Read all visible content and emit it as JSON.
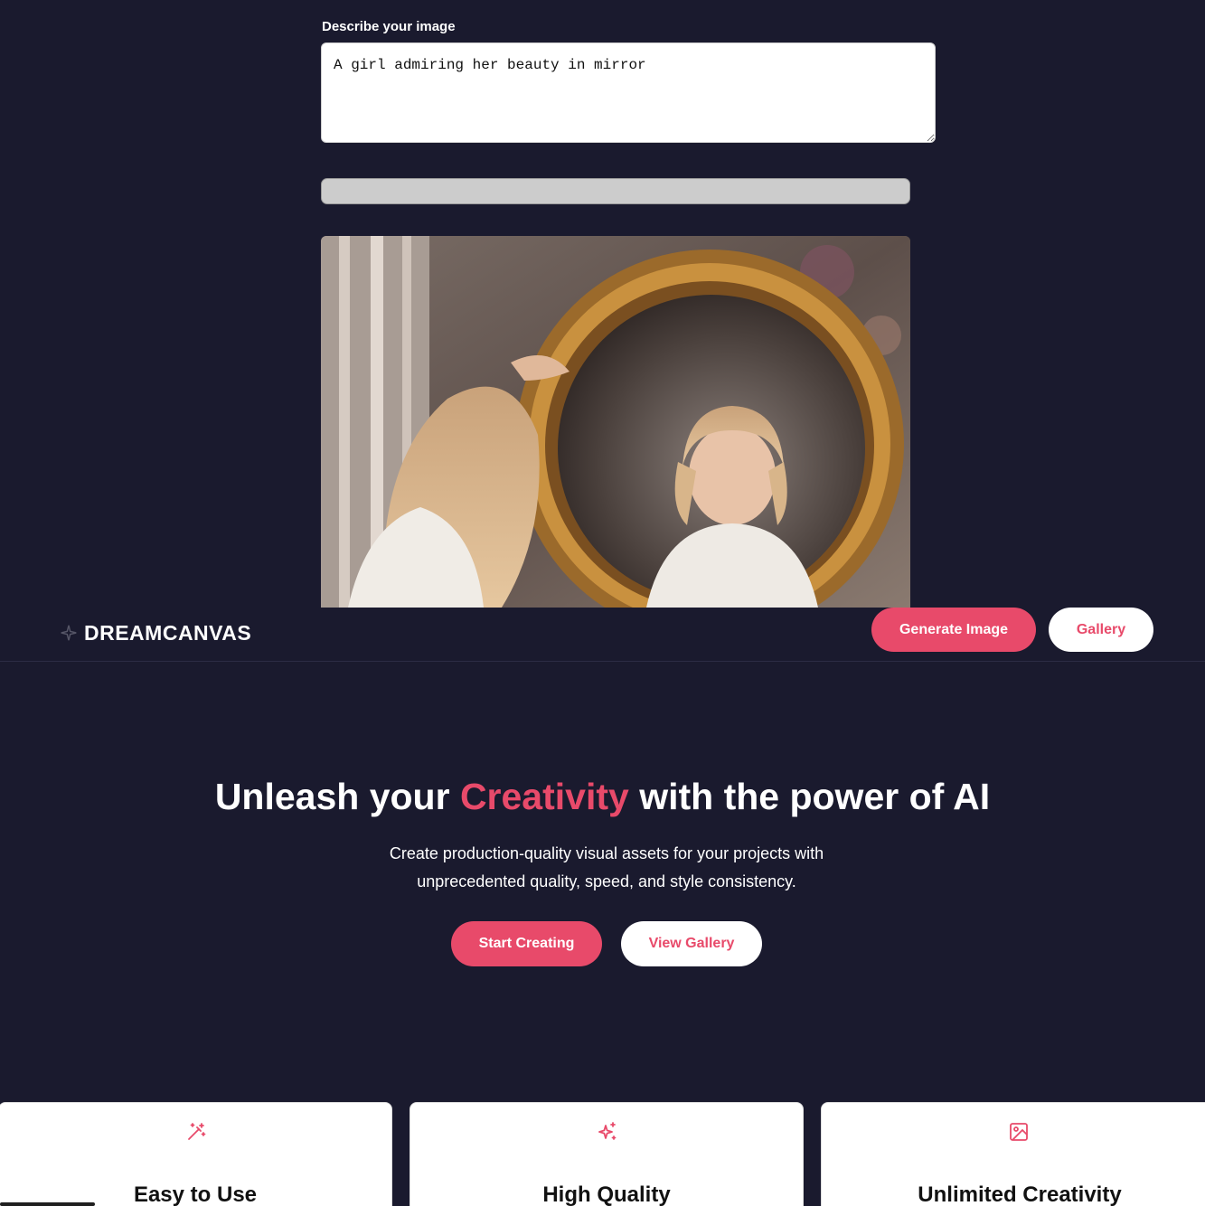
{
  "generator": {
    "label": "Describe your image",
    "prompt_value": "A girl admiring her beauty in mirror",
    "progress": 0,
    "image_alt": "A girl admiring her beauty in mirror"
  },
  "navbar": {
    "brand": "DREAMCANVAS",
    "brand_icon": "sparkle-icon",
    "generate_label": "Generate Image",
    "gallery_label": "Gallery"
  },
  "hero": {
    "title_pre": "Unleash your ",
    "title_accent": "Creativity",
    "title_post": " with the power of AI",
    "subtitle_line1": "Create production-quality visual assets for your projects with",
    "subtitle_line2": "unprecedented quality, speed, and style consistency.",
    "start_label": "Start Creating",
    "gallery_label": "View Gallery"
  },
  "features": [
    {
      "icon": "magic-wand-icon",
      "title": "Easy to Use"
    },
    {
      "icon": "sparkles-icon",
      "title": "High Quality"
    },
    {
      "icon": "image-icon",
      "title": "Unlimited Creativity"
    }
  ],
  "colors": {
    "background": "#1a1a2e",
    "accent": "#e84a6a",
    "card": "#ffffff"
  }
}
